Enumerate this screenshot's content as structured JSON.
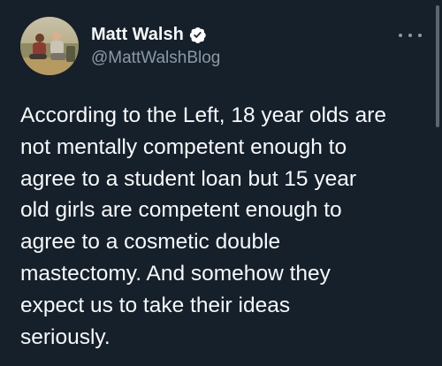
{
  "tweet": {
    "author": {
      "display_name": "Matt Walsh",
      "handle": "@MattWalshBlog",
      "verified": true,
      "avatar_icon": "profile-photo"
    },
    "more_icon": "more-horizontal-icon",
    "verified_icon": "verified-badge-icon",
    "text": "According to the Left, 18 year olds are\nnot mentally competent enough to\nagree to a student loan but 15 year\nold girls are competent enough to\nagree to a cosmetic double\nmastectomy. And somehow they\nexpect us to take their ideas\nseriously."
  },
  "colors": {
    "background": "#15202b",
    "primary_text": "#f7f9f9",
    "secondary_text": "#8b98a5",
    "verified_badge": "#ffffff"
  }
}
